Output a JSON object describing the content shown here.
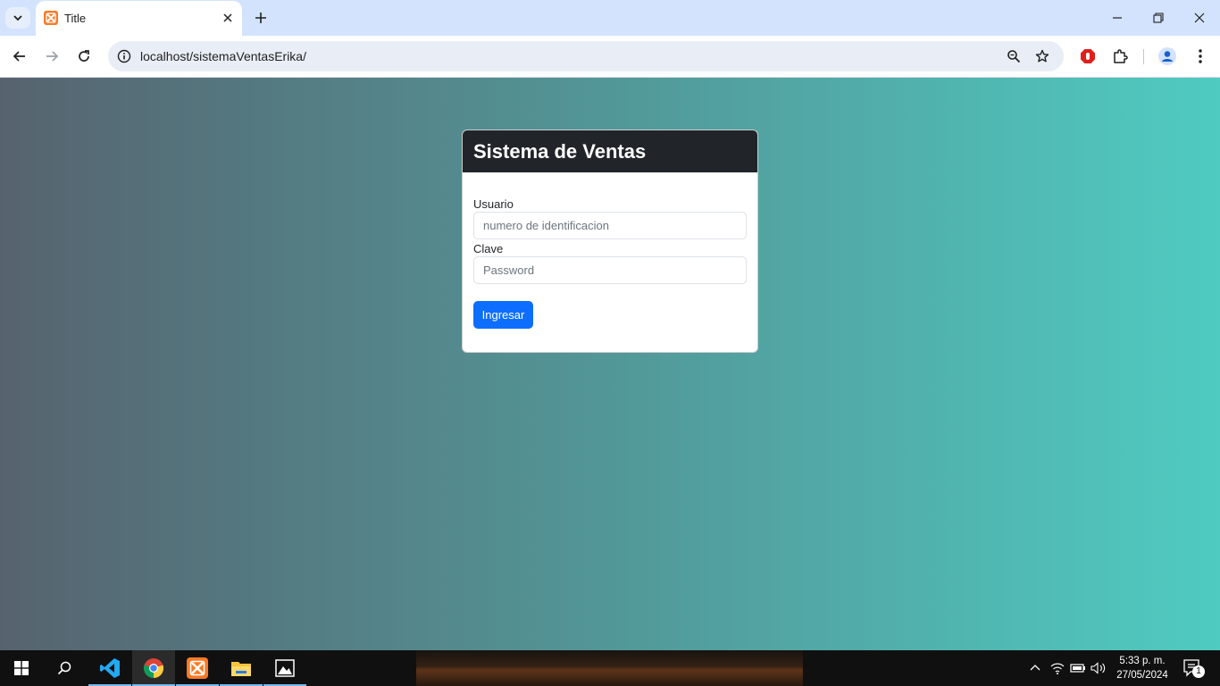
{
  "browser": {
    "tab": {
      "title": "Title"
    },
    "address": {
      "url": "localhost/sistemaVentasErika/"
    }
  },
  "login": {
    "header_title": "Sistema de Ventas",
    "usuario_label": "Usuario",
    "usuario_placeholder": "numero de identificacion",
    "clave_label": "Clave",
    "clave_placeholder": "Password",
    "submit_label": "Ingresar"
  },
  "taskbar": {
    "apps": [
      "start",
      "search",
      "vscode",
      "chrome",
      "xampp",
      "file-explorer",
      "photos"
    ],
    "time": "5:33 p. m.",
    "date": "27/05/2024",
    "notification_count": "1"
  },
  "colors": {
    "gradient_start": "#56636f",
    "gradient_end": "#4fcbc1",
    "card_header": "#212529",
    "primary_button": "#0d6efd",
    "chrome_frame": "#d3e3fd"
  }
}
